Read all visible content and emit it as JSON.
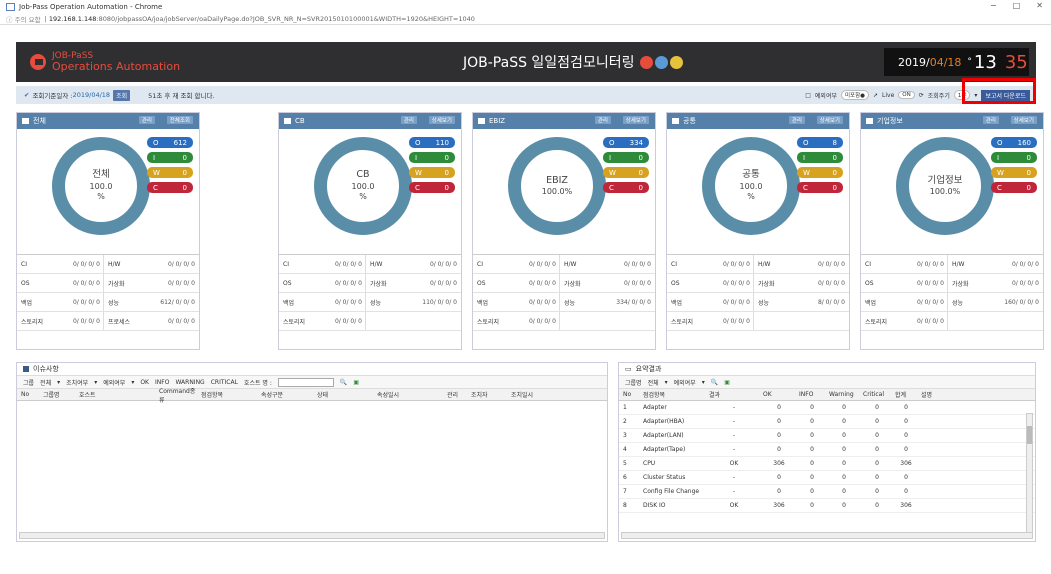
{
  "window": {
    "title": "Job-Pass Operation Automation - Chrome",
    "controls": [
      "−",
      "□",
      "✕"
    ]
  },
  "address": {
    "security": "ⓘ 주의 요함",
    "host": "192.168.1.148",
    "path": ":8080/jobpassOA/joa/jobServer/oaDailyPage.do?JOB_SVR_NR_N=SVR2015010100001&WIDTH=1920&HEIGHT=1040"
  },
  "header": {
    "logo_line1": "JOB-PaSS",
    "logo_line2": "Operations Automation",
    "title": "JOB-PaSS 일일점검모니터링",
    "dot_colors": [
      "#e74c3c",
      "#5b9bd5",
      "#e6c33b"
    ]
  },
  "clock": {
    "date_prefix": "2019/",
    "date_month": "04/18",
    "deg": "°",
    "hour": "13",
    "minute": "35"
  },
  "info": {
    "date_label": "조회기준일자 :",
    "date": "2019/04/18",
    "query_btn": "조회",
    "message": "51초 후 재 조회 합니다.",
    "exclude_label": "예외여부",
    "exclude_pill": "미포함●",
    "live_label": "Live",
    "live_toggle": "ON",
    "interval_label": "조회주기",
    "interval": "1분",
    "download_btn": "보고서 다운로드"
  },
  "cards": [
    {
      "title": "전체",
      "btn1": "관리",
      "btn2": "전체조회",
      "ring1": "전체",
      "ring2": "100.0",
      "ring3": "%",
      "o": "612",
      "i": "0",
      "w": "0",
      "c": "0",
      "rows": [
        [
          "CI",
          "0/ 0/ 0/ 0",
          "H/W",
          "0/ 0/ 0/ 0"
        ],
        [
          "OS",
          "0/ 0/ 0/ 0",
          "가상화",
          "0/ 0/ 0/ 0"
        ],
        [
          "백업",
          "0/ 0/ 0/ 0",
          "성능",
          "612/ 0/ 0/ 0"
        ],
        [
          "스토리지",
          "0/ 0/ 0/ 0",
          "프로세스",
          "0/ 0/ 0/ 0"
        ]
      ]
    },
    {
      "title": "CB",
      "btn1": "관리",
      "btn2": "상세보기",
      "ring1": "CB",
      "ring2": "100.0",
      "ring3": "%",
      "o": "110",
      "i": "0",
      "w": "0",
      "c": "0",
      "rows": [
        [
          "CI",
          "0/ 0/ 0/ 0",
          "H/W",
          "0/ 0/ 0/ 0"
        ],
        [
          "OS",
          "0/ 0/ 0/ 0",
          "가상화",
          "0/ 0/ 0/ 0"
        ],
        [
          "백업",
          "0/ 0/ 0/ 0",
          "성능",
          "110/ 0/ 0/ 0"
        ],
        [
          "스토리지",
          "0/ 0/ 0/ 0",
          "",
          ""
        ]
      ]
    },
    {
      "title": "EBIZ",
      "btn1": "관리",
      "btn2": "상세보기",
      "ring1": "EBIZ",
      "ring2": "100.0%",
      "ring3": "",
      "o": "334",
      "i": "0",
      "w": "0",
      "c": "0",
      "rows": [
        [
          "CI",
          "0/ 0/ 0/ 0",
          "H/W",
          "0/ 0/ 0/ 0"
        ],
        [
          "OS",
          "0/ 0/ 0/ 0",
          "가상화",
          "0/ 0/ 0/ 0"
        ],
        [
          "백업",
          "0/ 0/ 0/ 0",
          "성능",
          "334/ 0/ 0/ 0"
        ],
        [
          "스토리지",
          "0/ 0/ 0/ 0",
          "",
          ""
        ]
      ]
    },
    {
      "title": "공통",
      "btn1": "관리",
      "btn2": "상세보기",
      "ring1": "공통",
      "ring2": "100.0",
      "ring3": "%",
      "o": "8",
      "i": "0",
      "w": "0",
      "c": "0",
      "rows": [
        [
          "CI",
          "0/ 0/ 0/ 0",
          "H/W",
          "0/ 0/ 0/ 0"
        ],
        [
          "OS",
          "0/ 0/ 0/ 0",
          "가상화",
          "0/ 0/ 0/ 0"
        ],
        [
          "백업",
          "0/ 0/ 0/ 0",
          "성능",
          "8/ 0/ 0/ 0"
        ],
        [
          "스토리지",
          "0/ 0/ 0/ 0",
          "",
          ""
        ]
      ]
    },
    {
      "title": "기업정보",
      "btn1": "관리",
      "btn2": "상세보기",
      "ring1": "기업정보",
      "ring2": "100.0%",
      "ring3": "",
      "o": "160",
      "i": "0",
      "w": "0",
      "c": "0",
      "rows": [
        [
          "CI",
          "0/ 0/ 0/ 0",
          "H/W",
          "0/ 0/ 0/ 0"
        ],
        [
          "OS",
          "0/ 0/ 0/ 0",
          "가상화",
          "0/ 0/ 0/ 0"
        ],
        [
          "백업",
          "0/ 0/ 0/ 0",
          "성능",
          "160/ 0/ 0/ 0"
        ],
        [
          "스토리지",
          "0/ 0/ 0/ 0",
          "",
          ""
        ]
      ]
    }
  ],
  "issues": {
    "title": "이슈사항",
    "f_group": "그룹",
    "f_group_val": "전체",
    "f_ex": "조치여부",
    "f_exc": "예외여부",
    "f_ok": "OK",
    "f_info": "INFO",
    "f_warn": "WARNING",
    "f_crit": "CRITICAL",
    "f_host": "호스트 명 :",
    "columns": [
      "No",
      "그룹명",
      "호스트",
      "Command종류",
      "점검항목",
      "속성구분",
      "상태",
      "속성일시",
      "관리",
      "조치자",
      "조치일시"
    ]
  },
  "summary": {
    "title": "요약결과",
    "f_group": "그룹명",
    "f_group_val": "전체",
    "f_exc": "예외여부",
    "columns": [
      "No",
      "점검항목",
      "결과",
      "OK",
      "INFO",
      "Warning",
      "Critical",
      "합계",
      "설명"
    ],
    "rows": [
      [
        "1",
        "Adapter",
        "-",
        "0",
        "0",
        "0",
        "0",
        "0"
      ],
      [
        "2",
        "Adapter(HBA)",
        "-",
        "0",
        "0",
        "0",
        "0",
        "0"
      ],
      [
        "3",
        "Adapter(LAN)",
        "-",
        "0",
        "0",
        "0",
        "0",
        "0"
      ],
      [
        "4",
        "Adapter(Tape)",
        "-",
        "0",
        "0",
        "0",
        "0",
        "0"
      ],
      [
        "5",
        "CPU",
        "OK",
        "306",
        "0",
        "0",
        "0",
        "306"
      ],
      [
        "6",
        "Cluster Status",
        "-",
        "0",
        "0",
        "0",
        "0",
        "0"
      ],
      [
        "7",
        "Config File Change",
        "-",
        "0",
        "0",
        "0",
        "0",
        "0"
      ],
      [
        "8",
        "DISK IO",
        "OK",
        "306",
        "0",
        "0",
        "0",
        "306"
      ]
    ]
  }
}
